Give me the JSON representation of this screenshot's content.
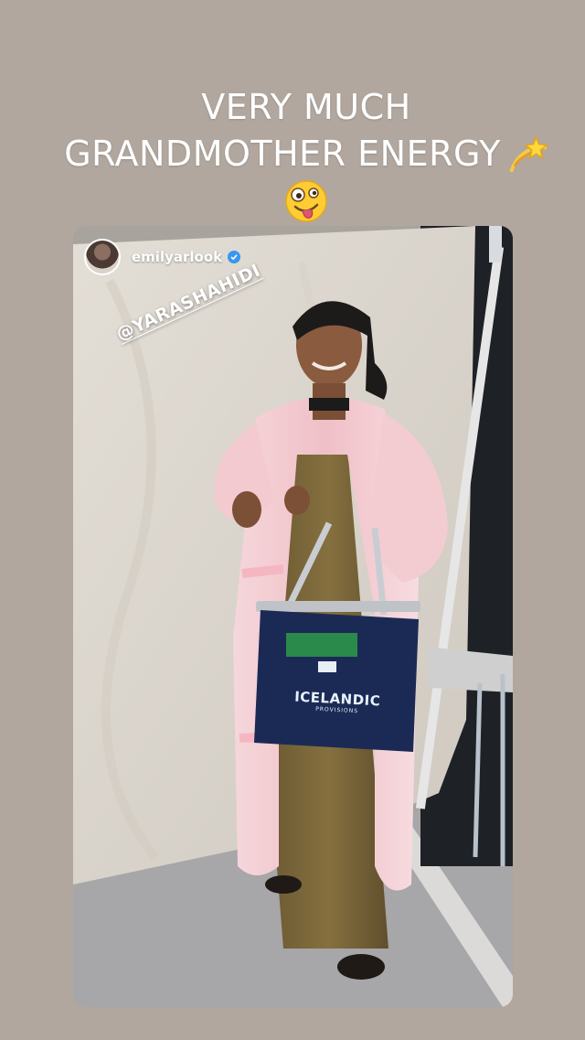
{
  "caption": {
    "line1": "VERY MUCH",
    "line2": "GRANDMOTHER ENERGY",
    "emoji_after_line2": "dizzy-emoji",
    "emoji_line3": "zany-face-emoji"
  },
  "story": {
    "username": "emilyarlook",
    "verified": true,
    "mention_sticker": "@YARASHAHIDI",
    "bag_brand": "ICELANDIC",
    "bag_brand_sub": "PROVISIONS"
  },
  "colors": {
    "background": "#b1a79f",
    "caption_text": "#ffffff",
    "verified_badge": "#3897f0",
    "coat": "#f2c9cf",
    "bag": "#1b2a55"
  }
}
